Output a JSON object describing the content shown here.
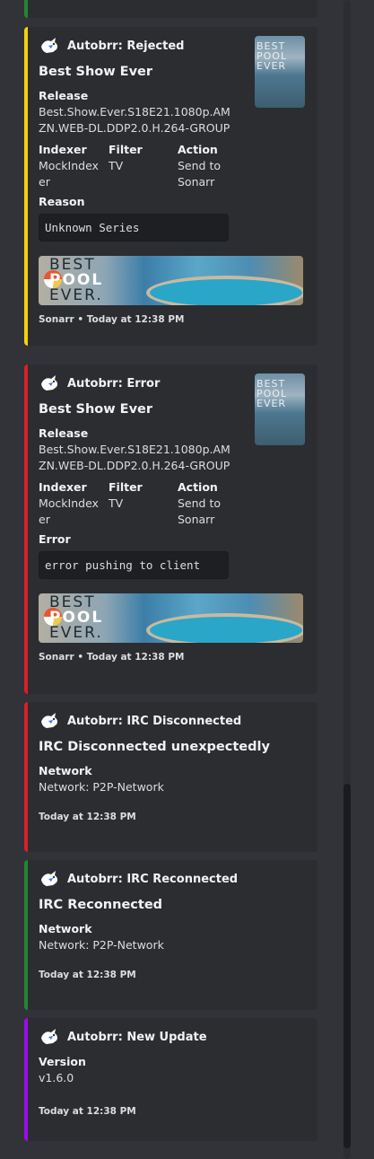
{
  "colors": {
    "rejected": "#f5d10a",
    "error": "#da1e28",
    "disconnected": "#da1e28",
    "reconnected": "#238636",
    "update": "#9b0dea",
    "top_partial": "#238636"
  },
  "embeds": {
    "rejected": {
      "author": "Autobrr: Rejected",
      "title": "Best Show Ever",
      "release_label": "Release",
      "release_value": "Best.Show.Ever.S18E21.1080p.AMZN.WEB-DL.DDP2.0.H.264-GROUP",
      "indexer_label": "Indexer",
      "indexer_value": "MockIndexer",
      "filter_label": "Filter",
      "filter_value": "TV",
      "action_label": "Action",
      "action_value": "Send to Sonarr",
      "reason_label": "Reason",
      "reason_value": "Unknown Series",
      "thumb_text": "BEST POOL EVER",
      "banner_text_1": "BEST",
      "banner_text_2": "POOL",
      "banner_text_3": "EVER.",
      "footer": "Sonarr • Today at 12:38 PM"
    },
    "error": {
      "author": "Autobrr: Error",
      "title": "Best Show Ever",
      "release_label": "Release",
      "release_value": "Best.Show.Ever.S18E21.1080p.AMZN.WEB-DL.DDP2.0.H.264-GROUP",
      "indexer_label": "Indexer",
      "indexer_value": "MockIndexer",
      "filter_label": "Filter",
      "filter_value": "TV",
      "action_label": "Action",
      "action_value": "Send to Sonarr",
      "error_label": "Error",
      "error_value": "error pushing to client",
      "thumb_text": "BEST POOL EVER",
      "banner_text_1": "BEST",
      "banner_text_2": "POOL",
      "banner_text_3": "EVER.",
      "footer": "Sonarr • Today at 12:38 PM"
    },
    "irc_disconnected": {
      "author": "Autobrr: IRC Disconnected",
      "title": "IRC Disconnected unexpectedly",
      "network_label": "Network",
      "network_value": "Network: P2P-Network",
      "footer": "Today at 12:38 PM"
    },
    "irc_reconnected": {
      "author": "Autobrr: IRC Reconnected",
      "title": "IRC Reconnected",
      "network_label": "Network",
      "network_value": "Network: P2P-Network",
      "footer": "Today at 12:38 PM"
    },
    "new_update": {
      "author": "Autobrr: New Update",
      "version_label": "Version",
      "version_value": "v1.6.0",
      "footer": "Today at 12:38 PM"
    }
  },
  "icons": {
    "author": "autobrr-bunny-icon"
  }
}
